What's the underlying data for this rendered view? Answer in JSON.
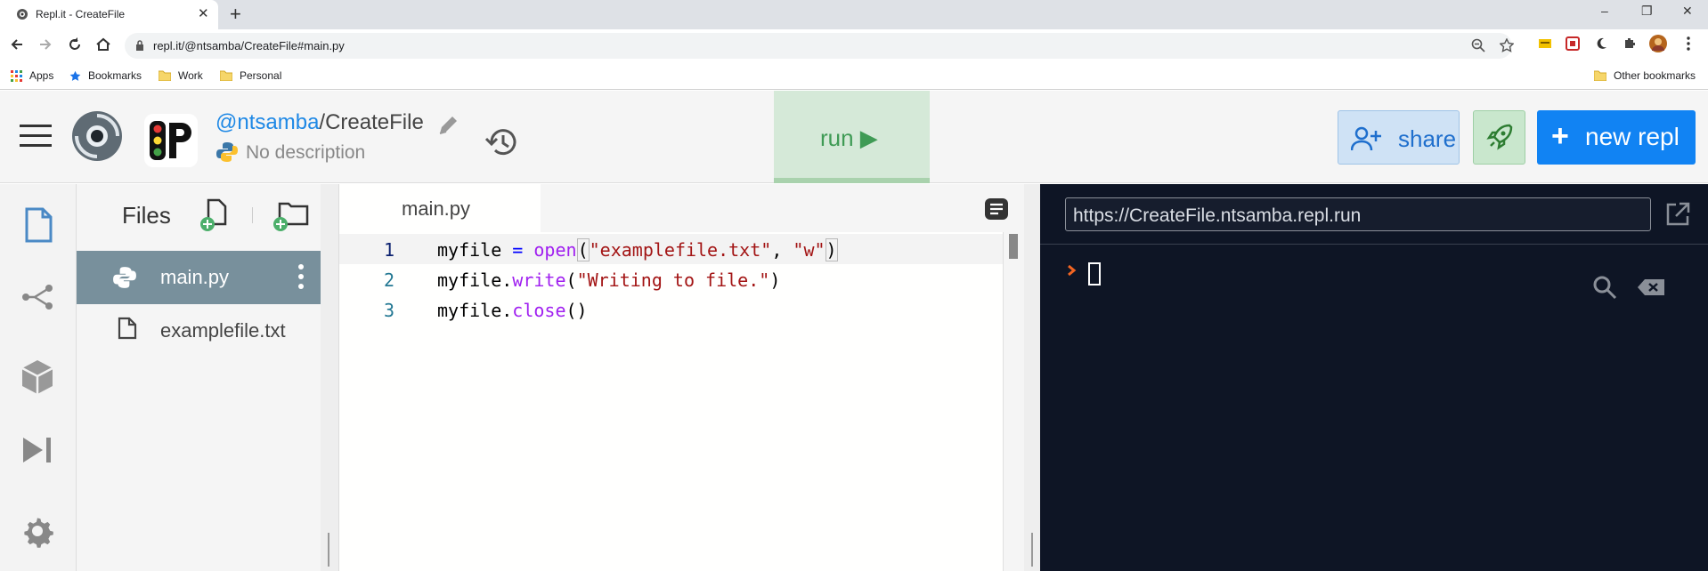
{
  "browser": {
    "tab_title": "Repl.it - CreateFile",
    "tab_close": "✕",
    "new_tab": "+",
    "window_controls": [
      "–",
      "❐",
      "✕"
    ],
    "url": "repl.it/@ntsamba/CreateFile#main.py",
    "bookmarks": [
      "Apps",
      "Bookmarks",
      "Work",
      "Personal"
    ],
    "other_bookmarks": "Other bookmarks"
  },
  "header": {
    "username": "@ntsamba",
    "slash": "/",
    "repl_name": "CreateFile",
    "description": "No description",
    "run_label": "run ▶",
    "share_label": "share",
    "new_repl_plus": "+",
    "new_repl_label": "new repl"
  },
  "files": {
    "title": "Files",
    "items": [
      {
        "name": "main.py",
        "active": true
      },
      {
        "name": "examplefile.txt",
        "active": false
      }
    ]
  },
  "editor": {
    "tab": "main.py",
    "lines": [
      {
        "num": "1",
        "code": "myfile = open(\"examplefile.txt\", \"w\")"
      },
      {
        "num": "2",
        "code": "myfile.write(\"Writing to file.\")"
      },
      {
        "num": "3",
        "code": "myfile.close()"
      }
    ]
  },
  "console": {
    "url": "https://CreateFile.ntsamba.repl.run"
  },
  "colors": {
    "accent_blue": "#1183f3",
    "run_green": "#3f9b55",
    "console_bg": "#0e1525",
    "active_file_bg": "#78909c"
  }
}
